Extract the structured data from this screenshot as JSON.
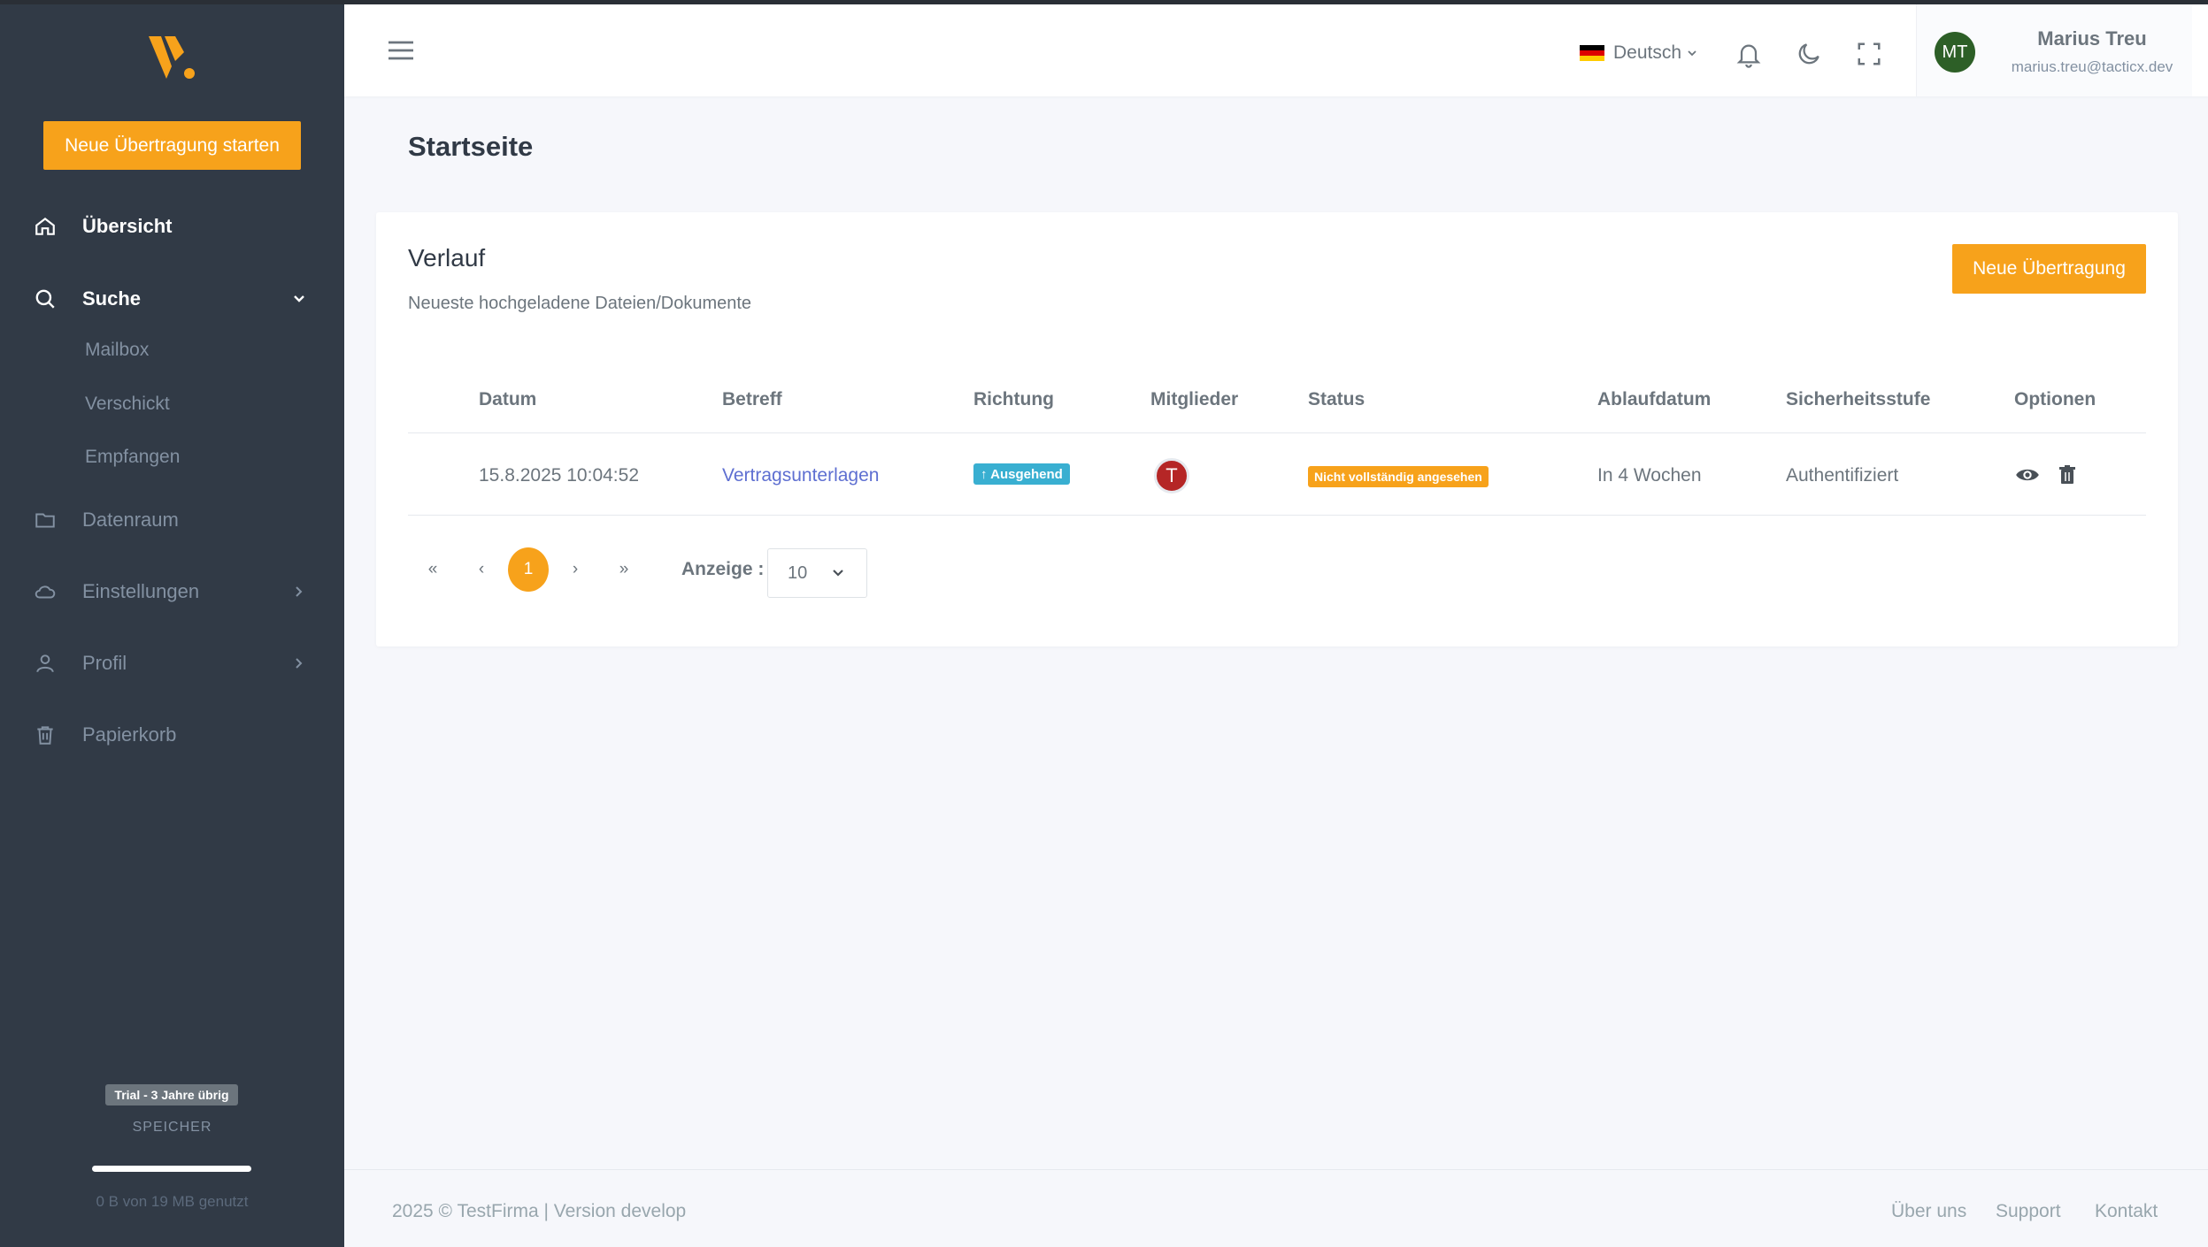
{
  "colors": {
    "accent": "#f7a21b",
    "sidebar_bg": "#313a46",
    "info": "#39afd1",
    "member_red": "#b52626"
  },
  "sidebar": {
    "start_button": "Neue Übertragung starten",
    "nav": {
      "overview": "Übersicht",
      "search": "Suche",
      "search_sub": [
        "Mailbox",
        "Verschickt",
        "Empfangen"
      ],
      "dataroom": "Datenraum",
      "settings": "Einstellungen",
      "profile": "Profil",
      "trash": "Papierkorb"
    },
    "trial_badge": "Trial - 3 Jahre übrig",
    "storage_label": "SPEICHER",
    "storage_used_fraction": 0.0,
    "storage_text": "0 B von 19 MB genutzt"
  },
  "topbar": {
    "language": "Deutsch",
    "user": {
      "initials": "MT",
      "name": "Marius Treu",
      "email": "marius.treu@tacticx.dev"
    }
  },
  "page": {
    "title": "Startseite"
  },
  "card": {
    "title": "Verlauf",
    "subtitle": "Neueste hochgeladene Dateien/Dokumente",
    "new_button": "Neue Übertragung",
    "columns": [
      "Datum",
      "Betreff",
      "Richtung",
      "Mitglieder",
      "Status",
      "Ablaufdatum",
      "Sicherheitsstufe",
      "Optionen"
    ],
    "rows": [
      {
        "date": "15.8.2025 10:04:52",
        "subject": "Vertragsunterlagen",
        "direction": "↑ Ausgehend",
        "member_initial": "T",
        "status": "Nicht vollständig angesehen",
        "expiry": "In 4 Wochen",
        "security": "Authentifiziert"
      }
    ],
    "pagination": {
      "first": "«",
      "prev": "‹",
      "current": "1",
      "next": "›",
      "last": "»"
    },
    "page_size_label": "Anzeige :",
    "page_size": "10"
  },
  "footer": {
    "text": "2025 © TestFirma | Version develop",
    "links": [
      "Über uns",
      "Support",
      "Kontakt"
    ]
  }
}
